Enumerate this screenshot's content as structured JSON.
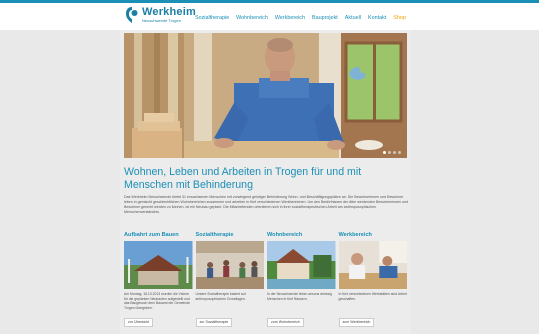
{
  "brand": {
    "name": "Werkheim",
    "tagline": "Neuschwende Trogen"
  },
  "nav": {
    "items": [
      "Sozialtherapie",
      "Wohnbereich",
      "Werkbereich",
      "Bauprojekt",
      "Aktuell",
      "Kontakt"
    ],
    "shop": "Shop"
  },
  "hero": {
    "slides": 4,
    "active_slide": 1
  },
  "headline": "Wohnen, Leben und Arbeiten in Trogen für und mit Menschen mit Behinderung",
  "intro": "Das Werkheim Neuschwende bietet 31 erwachsenen Menschen mit vorwiegend geistiger Behinderung Wohn- und Beschäftigungsplätze an. Die Bewohnerinnen und Bewohner leben in gemischt geschlechtlichen Wohnbereichen zusammen und arbeiten in fünf verschiedenen Werkbereichen. Um den Bedürfnissen der älter werdenden Bewohnerinnen und Bewohner gerecht werden zu können, ist ein Neubau geplant. Die Mitarbeitenden orientieren sich in ihrer sozialtherapeutischen Arbeit am anthroposophischen Menschenverständnis.",
  "columns": [
    {
      "title": "Aufbahrt zum Bauen",
      "text": "Am Montag, 18.10.2013 wurden die Visiere für die geplanten Neubauten aufgestellt und das Baugesuch dem Bauamt der Gemeinde Trogen übergeben.",
      "button": "zur Übersicht"
    },
    {
      "title": "Sozialtherapie",
      "text": "Unsere Sozialtherapie basiert auf anthroposophischen Grundlagen.",
      "button": "zur Sozialtherapie"
    },
    {
      "title": "Wohnbereich",
      "text": "In der Neuschwende leben ansons dreissig Menschen in fünf Häusern.",
      "button": "zum Wohnbereich"
    },
    {
      "title": "Werkbereich",
      "text": "In fünf verschiedenen Werkstätten sind Arbeit geschaffen.",
      "button": "zum Werkbereich"
    }
  ]
}
